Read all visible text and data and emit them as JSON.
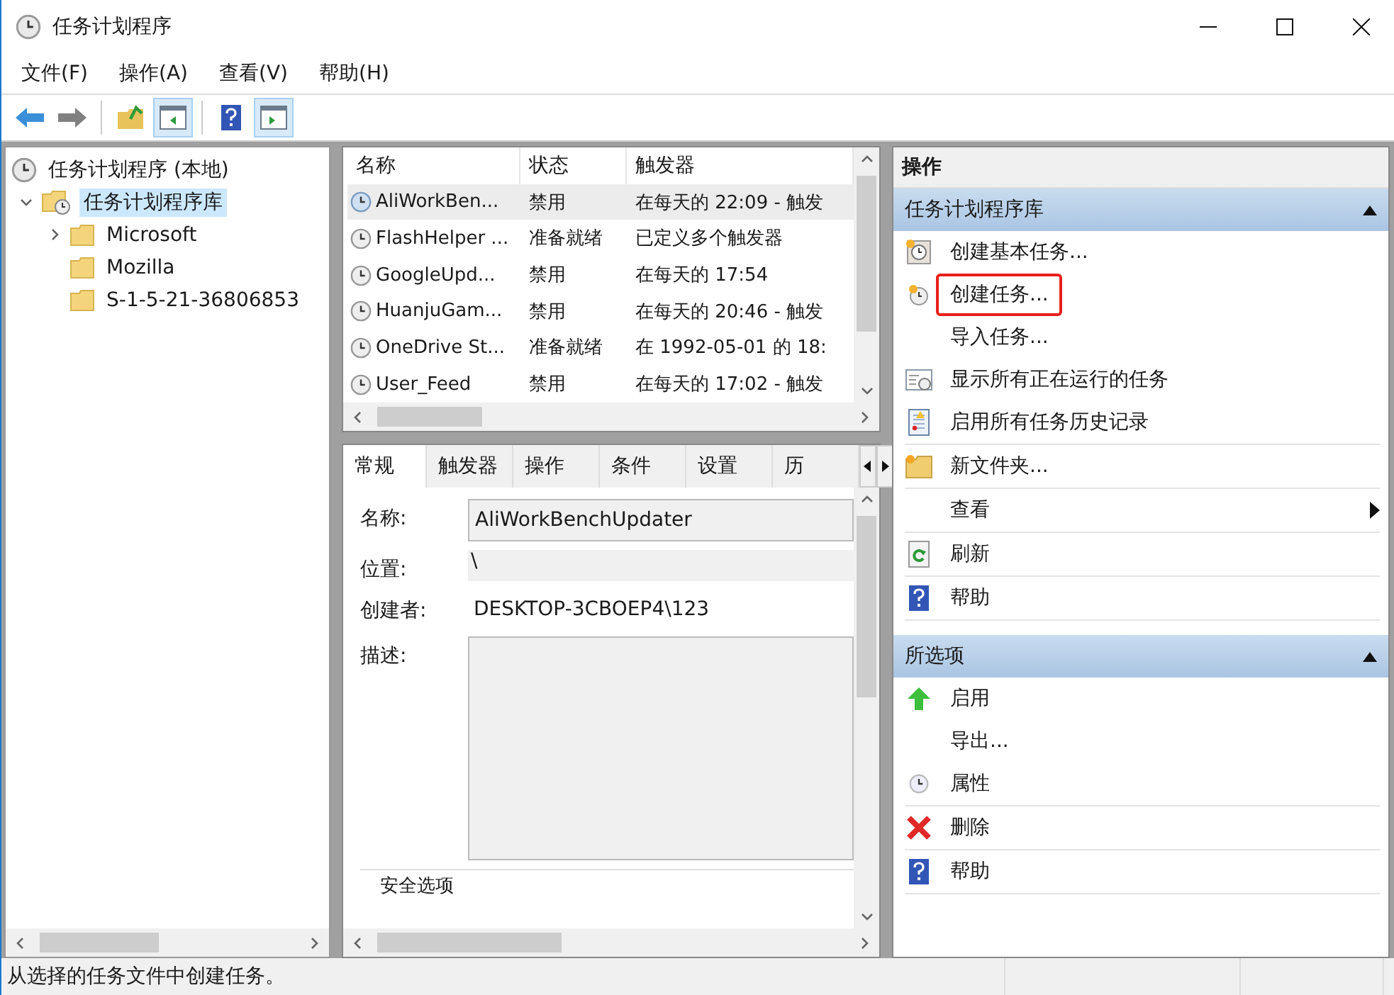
{
  "window": {
    "title": "任务计划程序"
  },
  "menu": [
    "文件(F)",
    "操作(A)",
    "查看(V)",
    "帮助(H)"
  ],
  "toolbar": [
    {
      "kind": "back",
      "on": false
    },
    {
      "kind": "forward",
      "on": false
    },
    {
      "kind": "up",
      "on": false
    },
    {
      "kind": "tree",
      "on": true
    },
    {
      "kind": "help",
      "on": false
    },
    {
      "kind": "pane",
      "on": true
    }
  ],
  "tree": {
    "label": "任务计划程序 (本地)",
    "children": [
      {
        "label": "任务计划程序库",
        "selected": true,
        "expanded": true,
        "children": [
          {
            "label": "Microsoft",
            "selected": false,
            "has_children": true
          },
          {
            "label": "Mozilla",
            "selected": false,
            "has_children": false
          },
          {
            "label": "S-1-5-21-36806853",
            "selected": false,
            "has_children": false
          }
        ]
      }
    ]
  },
  "task_list": {
    "columns": [
      "名称",
      "状态",
      "触发器"
    ],
    "rows": [
      {
        "name": "AliWorkBen...",
        "status": "禁用",
        "trigger": "在每天的 22:09 - 触发",
        "selected": true
      },
      {
        "name": "FlashHelper ...",
        "status": "准备就绪",
        "trigger": "已定义多个触发器",
        "selected": false
      },
      {
        "name": "GoogleUpd...",
        "status": "禁用",
        "trigger": "在每天的 17:54",
        "selected": false
      },
      {
        "name": "HuanjuGam...",
        "status": "禁用",
        "trigger": "在每天的 20:46 - 触发",
        "selected": false
      },
      {
        "name": "OneDrive St...",
        "status": "准备就绪",
        "trigger": "在 1992-05-01 的 18:",
        "selected": false
      },
      {
        "name": "User_Feed",
        "status": "禁用",
        "trigger": "在每天的 17:02 - 触发",
        "selected": false
      }
    ]
  },
  "details": {
    "tabs": [
      {
        "label": "常规",
        "selected": true
      },
      {
        "label": "触发器",
        "selected": false
      },
      {
        "label": "操作",
        "selected": false
      },
      {
        "label": "条件",
        "selected": false
      },
      {
        "label": "设置",
        "selected": false
      },
      {
        "label": "历",
        "selected": false
      }
    ],
    "fields": [
      {
        "kind": "input",
        "label": "名称:",
        "value": "AliWorkBenchUpdater"
      },
      {
        "kind": "plain",
        "label": "位置:",
        "value": "\\"
      },
      {
        "kind": "text",
        "label": "创建者:",
        "value": "DESKTOP-3CBOEP4\\123"
      },
      {
        "kind": "area",
        "label": "描述:"
      }
    ],
    "group_label": "安全选项"
  },
  "actions": {
    "title": "操作",
    "sections": [
      {
        "title": "任务计划程序库",
        "expanded": true,
        "groups": [
          [
            {
              "kind": "basic-task",
              "label": "创建基本任务...",
              "highlighted": false
            },
            {
              "kind": "task",
              "label": "创建任务...",
              "highlighted": true
            },
            {
              "kind": "none",
              "label": "导入任务...",
              "highlighted": false
            },
            {
              "kind": "running",
              "label": "显示所有正在运行的任务",
              "highlighted": false
            },
            {
              "kind": "history",
              "label": "启用所有任务历史记录",
              "highlighted": false
            }
          ],
          [
            {
              "kind": "folder",
              "label": "新文件夹...",
              "highlighted": false
            }
          ],
          [
            {
              "kind": "submenu",
              "label": "查看",
              "highlighted": false
            }
          ],
          [
            {
              "kind": "refresh",
              "label": "刷新",
              "highlighted": false
            }
          ],
          [
            {
              "kind": "help",
              "label": "帮助",
              "highlighted": false
            }
          ]
        ]
      },
      {
        "title": "所选项",
        "expanded": true,
        "groups": [
          [
            {
              "kind": "enable",
              "label": "启用",
              "highlighted": false
            },
            {
              "kind": "none",
              "label": "导出...",
              "highlighted": false
            },
            {
              "kind": "properties",
              "label": "属性",
              "highlighted": false
            }
          ],
          [
            {
              "kind": "delete",
              "label": "删除",
              "highlighted": false
            }
          ],
          [
            {
              "kind": "help",
              "label": "帮助",
              "highlighted": false
            }
          ]
        ]
      }
    ]
  },
  "status_bar": {
    "text": "从选择的任务文件中创建任务。"
  }
}
